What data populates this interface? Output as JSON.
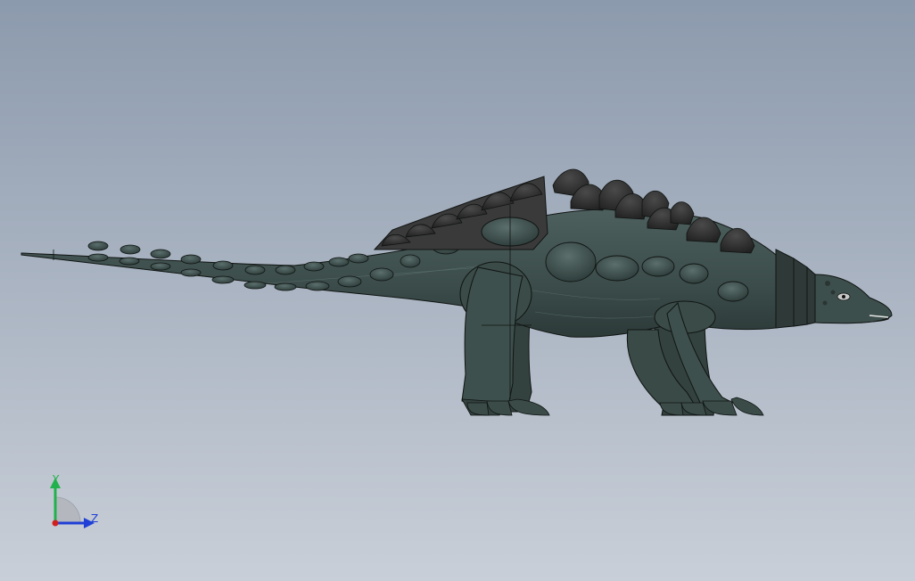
{
  "viewport": {
    "background_top": "#8c9aad",
    "background_bottom": "#c9cfd8"
  },
  "model": {
    "body_color": "#3b4c4a",
    "body_shade": "#2a3836",
    "armor_color": "#2b2b2b",
    "outline_color": "#101412"
  },
  "triad": {
    "y_label": "Y",
    "z_label": "Z",
    "y_color": "#22b14c",
    "z_color": "#1f3fd6",
    "x_color": "#d11f1f"
  }
}
